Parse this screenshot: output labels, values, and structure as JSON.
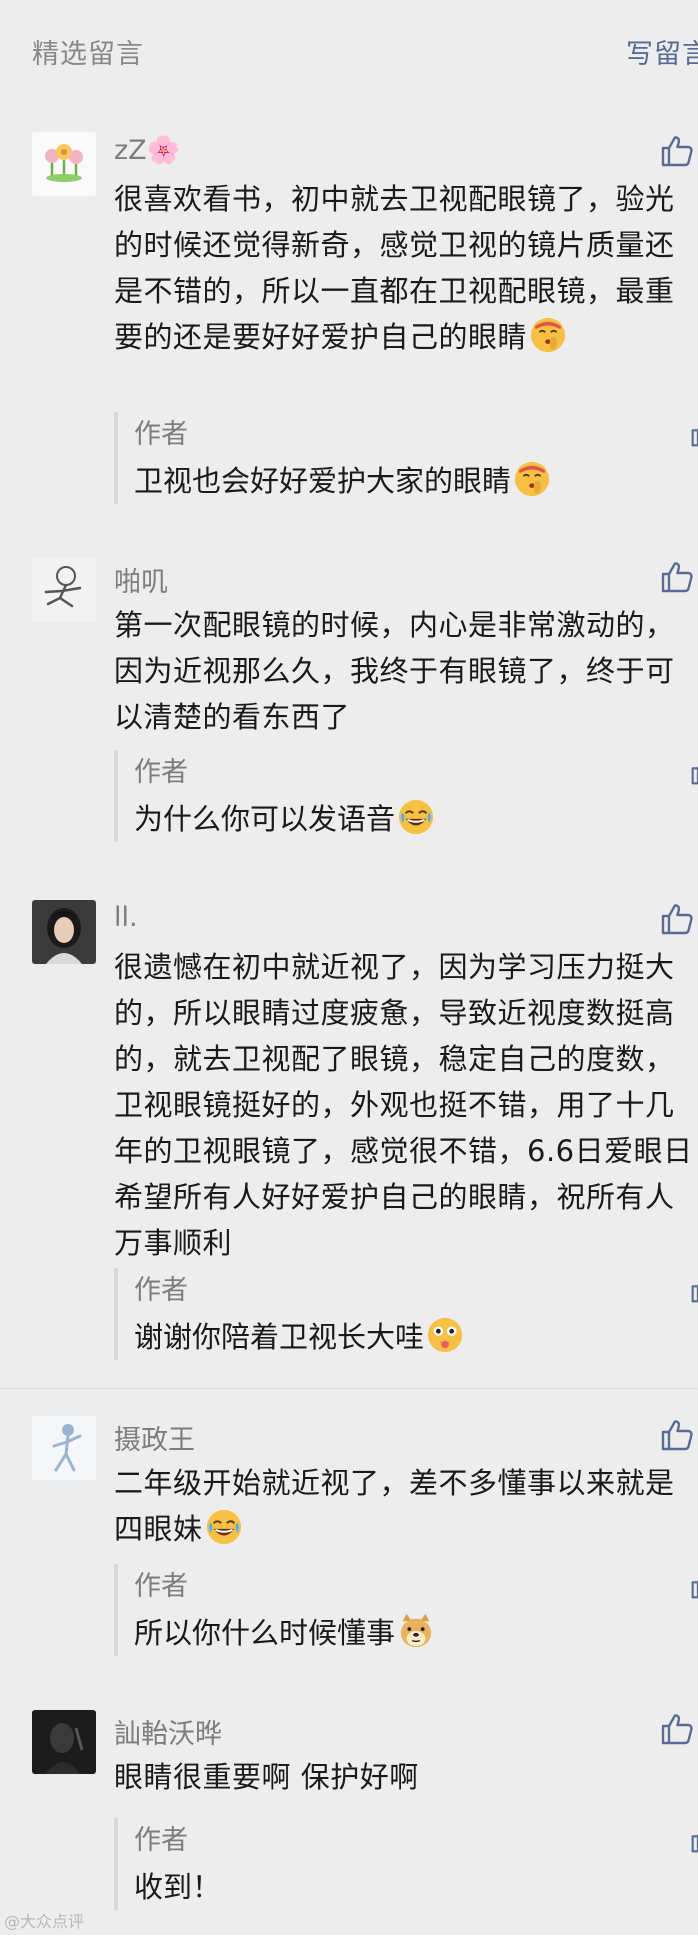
{
  "header": {
    "title": "精选留言",
    "write_label": "写留言"
  },
  "comments": [
    {
      "nickname": "zZ🌸",
      "text": "很喜欢看书，初中就去卫视配眼镜了，验光的时候还觉得新奇，感觉卫视的镜片质量还是不错的，所以一直都在卫视配眼镜，最重要的还是要好好爱护自己的眼睛",
      "emoji": "shush-emoji",
      "reply_author": "作者",
      "reply_text": "卫视也会好好爱护大家的眼睛",
      "reply_emoji": "shush-emoji"
    },
    {
      "nickname": "啪叽",
      "text": "第一次配眼镜的时候，内心是非常激动的，因为近视那么久，我终于有眼镜了，终于可以清楚的看东西了",
      "reply_author": "作者",
      "reply_text": "为什么你可以发语音",
      "reply_emoji": "tears-of-joy-emoji"
    },
    {
      "nickname": "ll.",
      "text": "很遗憾在初中就近视了，因为学习压力挺大的，所以眼睛过度疲惫，导致近视度数挺高的，就去卫视配了眼镜，稳定自己的度数，卫视眼镜挺好的，外观也挺不错，用了十几年的卫视眼镜了，感觉很不错，6.6日爱眼日希望所有人好好爱护自己的眼睛，祝所有人万事顺利",
      "reply_author": "作者",
      "reply_text": "谢谢你陪着卫视长大哇",
      "reply_emoji": "wow-emoji"
    },
    {
      "nickname": "摄政王",
      "text": "二年级开始就近视了，差不多懂事以来就是四眼妹",
      "emoji": "crying-laugh-emoji",
      "reply_author": "作者",
      "reply_text": "所以你什么时候懂事",
      "reply_emoji": "doge-emoji"
    },
    {
      "nickname": "訕軩沃晔",
      "text": "眼睛很重要啊 保护好啊",
      "reply_author": "作者",
      "reply_text": "收到！"
    }
  ],
  "watermark": "@大众点评"
}
